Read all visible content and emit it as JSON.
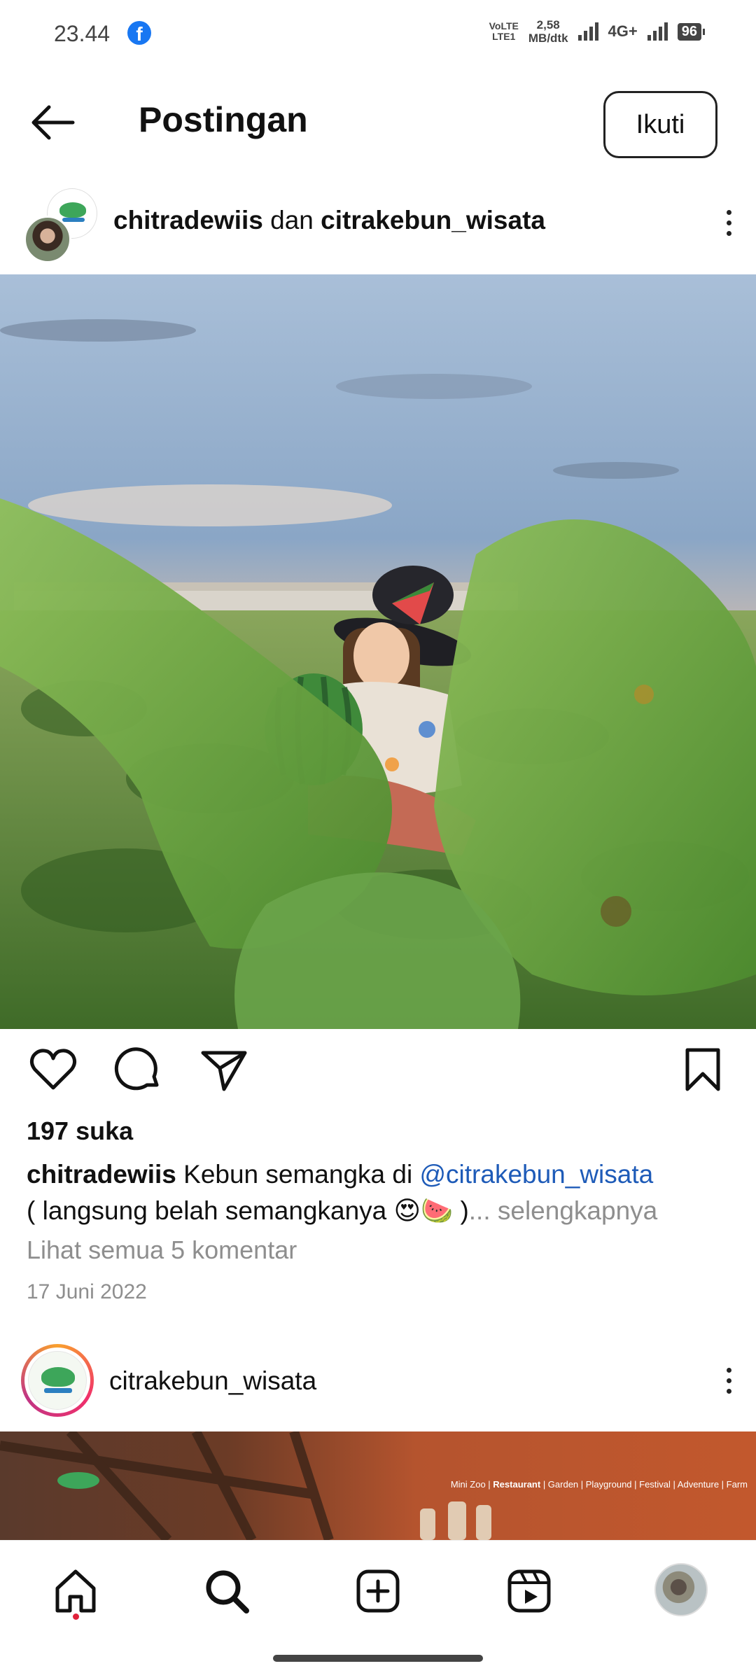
{
  "status_bar": {
    "time": "23.44",
    "volte_label_1": "VoLTE",
    "volte_label_2": "LTE1",
    "speed_value": "2,58",
    "speed_unit": "MB/dtk",
    "network": "4G+",
    "battery": "96"
  },
  "header": {
    "title": "Postingan",
    "follow_label": "Ikuti"
  },
  "post": {
    "author": "chitradewiis",
    "conjunction": "dan",
    "collaborator": "citrakebun_wisata",
    "likes": "197 suka",
    "caption_user": "chitradewiis",
    "caption_text": "Kebun semangka di",
    "caption_mention": "@citrakebun_wisata",
    "caption_text2": "( langsung belah semangkanya 😍🍉 )",
    "caption_more": "... selengkapnya",
    "view_comments": "Lihat semua 5 komentar",
    "date": "17 Juni 2022"
  },
  "post2": {
    "author": "citrakebun_wisata",
    "tags_1": "Mini Zoo | ",
    "tags_bold": "Restaurant",
    "tags_2": " | Garden | Playground | Festival | Adventure | Farm"
  },
  "colors": {
    "mention": "#1e5bb8",
    "muted": "#8e8e8e",
    "notification_dot": "#e0213a"
  },
  "icons": {
    "back": "arrow-left-icon",
    "like": "heart-icon",
    "comment": "comment-bubble-icon",
    "share": "paper-plane-icon",
    "save": "bookmark-icon",
    "home": "home-icon",
    "search": "search-icon",
    "create": "plus-square-icon",
    "reels": "reels-icon"
  }
}
